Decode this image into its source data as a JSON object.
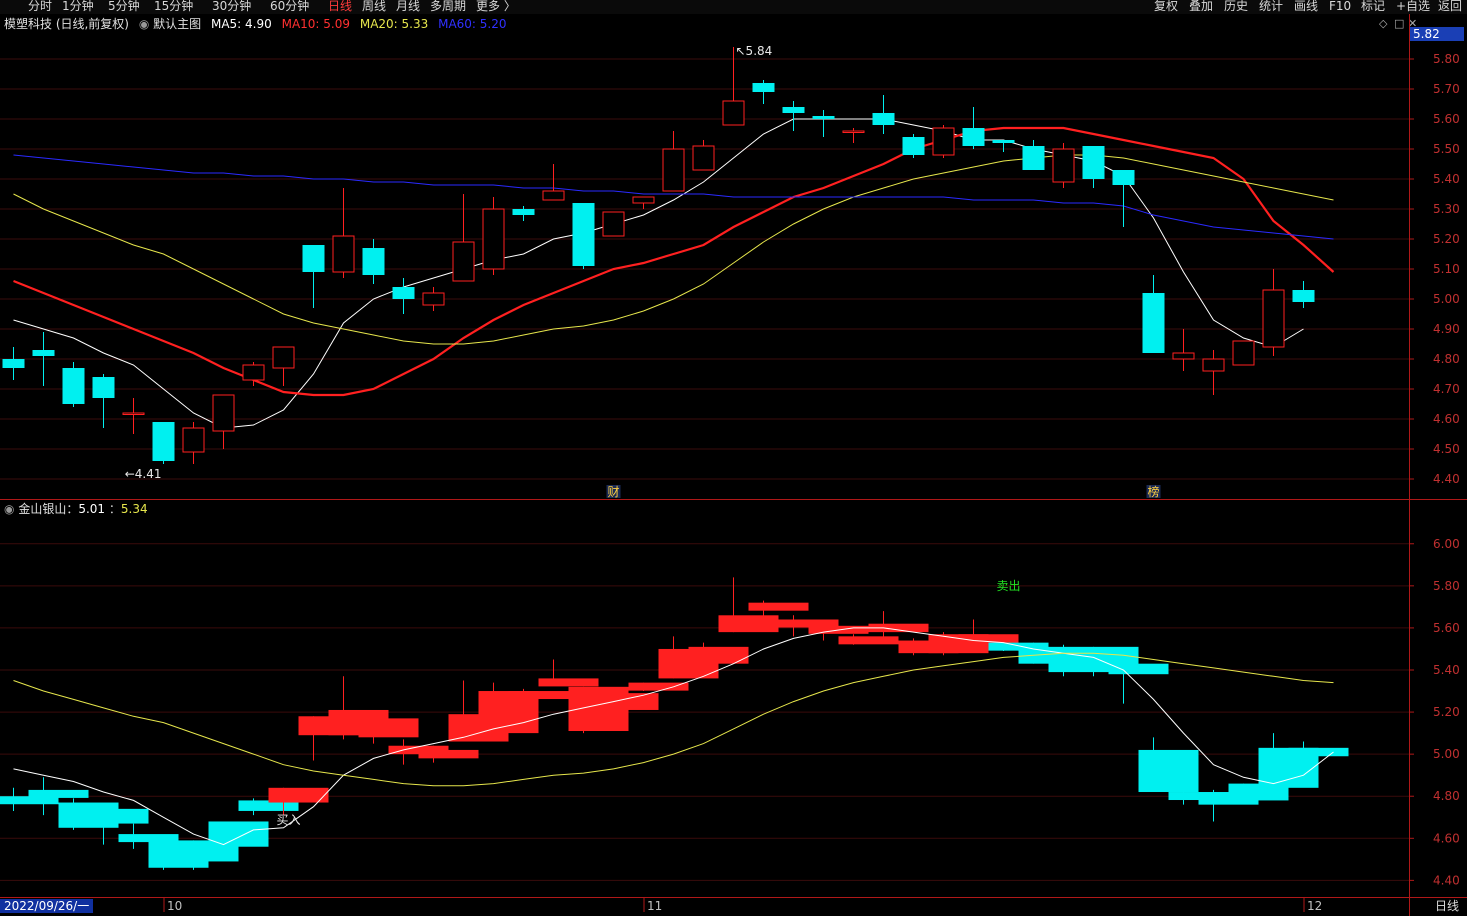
{
  "toolbar": {
    "left": [
      "分时",
      "1分钟",
      "5分钟",
      "15分钟",
      "30分钟",
      "60分钟",
      "日线",
      "周线",
      "月线",
      "多周期",
      "更多 〉"
    ],
    "active": "日线",
    "right": [
      "复权",
      "叠加",
      "历史",
      "统计",
      "画线",
      "F10",
      "标记",
      "+自选",
      "返回"
    ]
  },
  "header": {
    "stock": "模塑科技 (日线,前复权)",
    "template": "默认主图",
    "ma5": "MA5: 4.90",
    "ma10": "MA10: 5.09",
    "ma20": "MA20: 5.33",
    "ma60": "MA60: 5.20"
  },
  "sub_header": {
    "name": "金山银山：",
    "v1": "5.01",
    "sep": "：",
    "v2": "5.34"
  },
  "colors": {
    "up": "#ff2020",
    "down": "#00f0f0",
    "ma5": "#ffffff",
    "ma10": "#ff2020",
    "ma20": "#e6e64c",
    "ma60": "#2a2aff",
    "axis": "#b01818"
  },
  "chart_data": [
    {
      "type": "candlestick",
      "title": "模塑科技 日线",
      "y_ticks": [
        "5.80",
        "5.70",
        "5.60",
        "5.50",
        "5.40",
        "5.30",
        "5.20",
        "5.10",
        "5.00",
        "4.90",
        "4.80",
        "4.70",
        "4.60",
        "4.50",
        "4.40"
      ],
      "ylim": [
        4.37,
        5.88
      ],
      "current_price": "5.82",
      "max_label": "5.84",
      "min_label": "4.41",
      "markers": [
        {
          "text": "财",
          "index": 20
        },
        {
          "text": "榜",
          "index": 38
        }
      ],
      "candles": [
        [
          4.8,
          4.77,
          4.84,
          4.73
        ],
        [
          4.83,
          4.81,
          4.89,
          4.71
        ],
        [
          4.77,
          4.65,
          4.79,
          4.64
        ],
        [
          4.74,
          4.67,
          4.75,
          4.57
        ],
        [
          4.62,
          4.62,
          4.67,
          4.55
        ],
        [
          4.59,
          4.46,
          4.59,
          4.45
        ],
        [
          4.49,
          4.57,
          4.59,
          4.45
        ],
        [
          4.56,
          4.68,
          4.68,
          4.5
        ],
        [
          4.73,
          4.78,
          4.79,
          4.71
        ],
        [
          4.77,
          4.84,
          4.84,
          4.71
        ],
        [
          5.18,
          5.09,
          5.18,
          4.97
        ],
        [
          5.09,
          5.21,
          5.37,
          5.07
        ],
        [
          5.17,
          5.08,
          5.2,
          5.05
        ],
        [
          5.04,
          5.0,
          5.07,
          4.95
        ],
        [
          4.98,
          5.02,
          5.04,
          4.96
        ],
        [
          5.06,
          5.19,
          5.35,
          5.06
        ],
        [
          5.1,
          5.3,
          5.34,
          5.08
        ],
        [
          5.3,
          5.28,
          5.31,
          5.26
        ],
        [
          5.33,
          5.36,
          5.45,
          5.33
        ],
        [
          5.32,
          5.11,
          5.32,
          5.1
        ],
        [
          5.21,
          5.29,
          5.29,
          5.21
        ],
        [
          5.32,
          5.34,
          5.34,
          5.3
        ],
        [
          5.36,
          5.5,
          5.56,
          5.36
        ],
        [
          5.43,
          5.51,
          5.53,
          5.43
        ],
        [
          5.58,
          5.66,
          5.84,
          5.58
        ],
        [
          5.72,
          5.69,
          5.73,
          5.65
        ],
        [
          5.64,
          5.62,
          5.66,
          5.56
        ],
        [
          5.61,
          5.6,
          5.63,
          5.54
        ],
        [
          5.56,
          5.56,
          5.57,
          5.52
        ],
        [
          5.62,
          5.58,
          5.68,
          5.55
        ],
        [
          5.54,
          5.48,
          5.55,
          5.47
        ],
        [
          5.48,
          5.57,
          5.58,
          5.47
        ],
        [
          5.57,
          5.51,
          5.64,
          5.5
        ],
        [
          5.53,
          5.52,
          5.53,
          5.49
        ],
        [
          5.51,
          5.43,
          5.53,
          5.43
        ],
        [
          5.39,
          5.5,
          5.52,
          5.37
        ],
        [
          5.51,
          5.4,
          5.51,
          5.37
        ],
        [
          5.43,
          5.38,
          5.43,
          5.24
        ],
        [
          5.02,
          4.82,
          5.08,
          4.82
        ],
        [
          4.8,
          4.82,
          4.9,
          4.76
        ],
        [
          4.76,
          4.8,
          4.83,
          4.68
        ],
        [
          4.78,
          4.86,
          4.86,
          4.78
        ],
        [
          4.84,
          5.03,
          5.1,
          4.81
        ],
        [
          5.03,
          4.99,
          5.06,
          4.97
        ]
      ],
      "series": [
        {
          "name": "MA5",
          "values": [
            4.93,
            4.9,
            4.87,
            4.82,
            4.78,
            4.7,
            4.62,
            4.57,
            4.58,
            4.63,
            4.75,
            4.92,
            5.0,
            5.04,
            5.07,
            5.1,
            5.13,
            5.15,
            5.2,
            5.22,
            5.25,
            5.28,
            5.33,
            5.39,
            5.47,
            5.55,
            5.6,
            5.6,
            5.6,
            5.6,
            5.58,
            5.56,
            5.53,
            5.53,
            5.5,
            5.48,
            5.46,
            5.41,
            5.27,
            5.09,
            4.93,
            4.87,
            4.84,
            4.9
          ]
        },
        {
          "name": "MA10",
          "values": [
            5.06,
            5.02,
            4.98,
            4.94,
            4.9,
            4.86,
            4.82,
            4.77,
            4.73,
            4.69,
            4.68,
            4.68,
            4.7,
            4.75,
            4.8,
            4.87,
            4.93,
            4.98,
            5.02,
            5.06,
            5.1,
            5.12,
            5.15,
            5.18,
            5.24,
            5.29,
            5.34,
            5.37,
            5.41,
            5.45,
            5.5,
            5.53,
            5.56,
            5.57,
            5.57,
            5.57,
            5.55,
            5.53,
            5.51,
            5.49,
            5.47,
            5.4,
            5.26,
            5.18,
            5.09
          ]
        },
        {
          "name": "MA20",
          "values": [
            5.35,
            5.3,
            5.26,
            5.22,
            5.18,
            5.15,
            5.1,
            5.05,
            5.0,
            4.95,
            4.92,
            4.9,
            4.88,
            4.86,
            4.85,
            4.85,
            4.86,
            4.88,
            4.9,
            4.91,
            4.93,
            4.96,
            5.0,
            5.05,
            5.12,
            5.19,
            5.25,
            5.3,
            5.34,
            5.37,
            5.4,
            5.42,
            5.44,
            5.46,
            5.47,
            5.48,
            5.48,
            5.47,
            5.45,
            5.43,
            5.41,
            5.39,
            5.37,
            5.35,
            5.33
          ]
        },
        {
          "name": "MA60",
          "values": [
            5.48,
            5.47,
            5.46,
            5.45,
            5.44,
            5.43,
            5.42,
            5.42,
            5.41,
            5.41,
            5.4,
            5.4,
            5.39,
            5.39,
            5.38,
            5.38,
            5.38,
            5.37,
            5.37,
            5.36,
            5.36,
            5.35,
            5.35,
            5.35,
            5.34,
            5.34,
            5.34,
            5.34,
            5.34,
            5.34,
            5.34,
            5.34,
            5.33,
            5.33,
            5.33,
            5.32,
            5.32,
            5.31,
            5.28,
            5.26,
            5.24,
            5.23,
            5.22,
            5.21,
            5.2
          ]
        }
      ]
    },
    {
      "type": "candlestick",
      "title": "金山银山",
      "y_ticks": [
        "6.00",
        "5.80",
        "5.60",
        "5.40",
        "5.20",
        "5.00",
        "4.80",
        "4.60",
        "4.40"
      ],
      "ylim": [
        4.34,
        6.17
      ],
      "signals": [
        {
          "text": "买入",
          "index": 9
        },
        {
          "text": "卖出",
          "index": 33
        }
      ],
      "series": [
        {
          "name": "line1",
          "values": [
            4.93,
            4.9,
            4.87,
            4.82,
            4.78,
            4.7,
            4.62,
            4.57,
            4.64,
            4.65,
            4.75,
            4.9,
            4.98,
            5.02,
            5.05,
            5.08,
            5.12,
            5.15,
            5.19,
            5.22,
            5.25,
            5.28,
            5.32,
            5.37,
            5.43,
            5.5,
            5.55,
            5.58,
            5.6,
            5.6,
            5.58,
            5.56,
            5.54,
            5.53,
            5.5,
            5.48,
            5.46,
            5.4,
            5.26,
            5.1,
            4.95,
            4.89,
            4.86,
            4.9,
            5.01
          ]
        },
        {
          "name": "line2",
          "values": [
            5.35,
            5.3,
            5.26,
            5.22,
            5.18,
            5.15,
            5.1,
            5.05,
            5.0,
            4.95,
            4.92,
            4.9,
            4.88,
            4.86,
            4.85,
            4.85,
            4.86,
            4.88,
            4.9,
            4.91,
            4.93,
            4.96,
            5.0,
            5.05,
            5.12,
            5.19,
            5.25,
            5.3,
            5.34,
            5.37,
            5.4,
            5.42,
            5.44,
            5.46,
            5.47,
            5.48,
            5.48,
            5.47,
            5.45,
            5.43,
            5.41,
            5.39,
            5.37,
            5.35,
            5.34
          ]
        }
      ]
    }
  ],
  "x_ticks": [
    {
      "label": "10",
      "index": 5
    },
    {
      "label": "11",
      "index": 21
    },
    {
      "label": "12",
      "index": 43
    }
  ],
  "date_label": "2022/09/26/一",
  "period": "日线"
}
